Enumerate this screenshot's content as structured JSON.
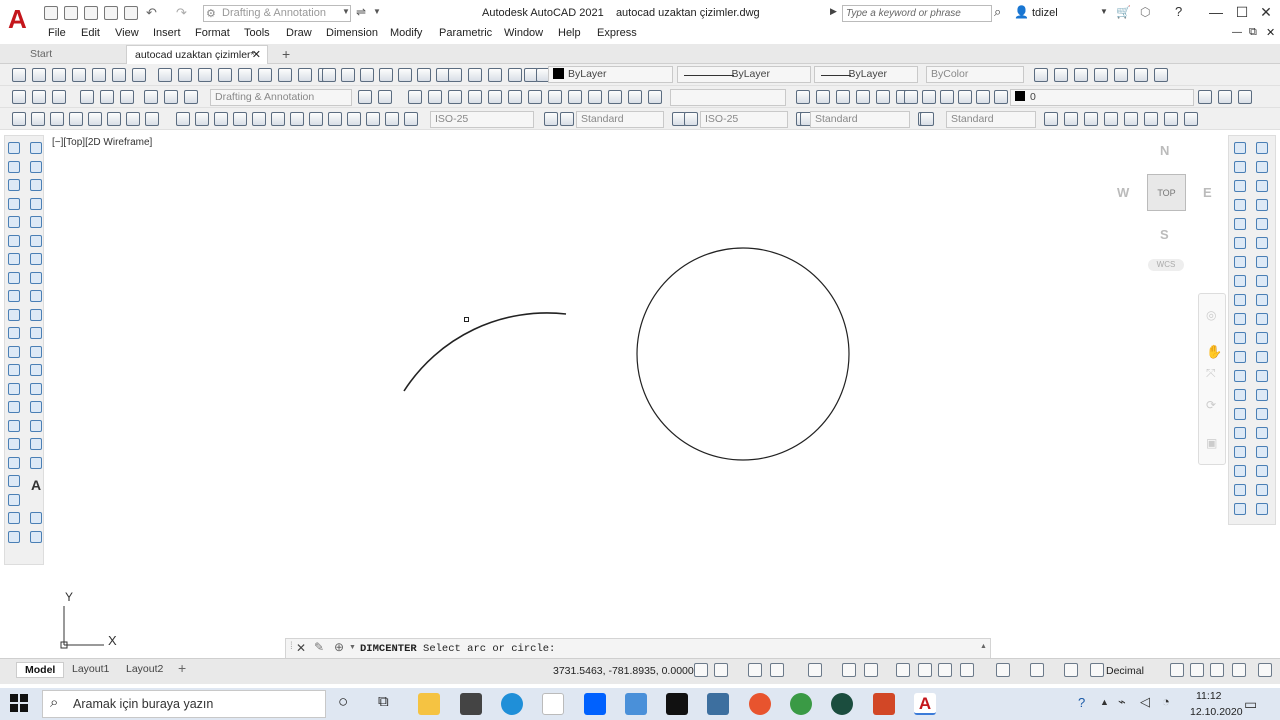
{
  "titlebar": {
    "workspace": "Drafting & Annotation",
    "app_title": "Autodesk AutoCAD 2021",
    "file_title": "autocad uzaktan çizimler.dwg",
    "search_placeholder": "Type a keyword or phrase",
    "user": "tdizel"
  },
  "menu": [
    "File",
    "Edit",
    "View",
    "Insert",
    "Format",
    "Tools",
    "Draw",
    "Dimension",
    "Modify",
    "Parametric",
    "Window",
    "Help",
    "Express"
  ],
  "tabs": {
    "start": "Start",
    "drawing": "autocad uzaktan çizimler*",
    "add": "+"
  },
  "toolbar1": {
    "color": "ByLayer",
    "linetype": "ByLayer",
    "lineweight": "ByLayer",
    "plotstyle": "ByColor"
  },
  "toolbar2": {
    "workspace": "Drafting & Annotation",
    "layer": "0"
  },
  "toolbar3": {
    "dimstyle": "ISO-25",
    "textstyle": "Standard",
    "dimstyle2": "ISO-25",
    "tablestyle": "Standard",
    "mleaderstyle": "Standard"
  },
  "viewport": {
    "label": "[−][Top][2D Wireframe]"
  },
  "viewcube": {
    "north": "N",
    "south": "S",
    "east": "E",
    "west": "W",
    "face": "TOP",
    "wcs": "WCS"
  },
  "ucs": {
    "x": "X",
    "y": "Y"
  },
  "command": {
    "name": "DIMCENTER",
    "prompt": "Select arc or circle:"
  },
  "layout_tabs": [
    "Model",
    "Layout1",
    "Layout2"
  ],
  "status": {
    "coords": "3731.5463, -781.8935, 0.0000",
    "units": "Decimal"
  },
  "taskbar": {
    "search_text": "Aramak için buraya yazın",
    "time": "11:12",
    "date": "12.10.2020"
  },
  "colors": {
    "accent": "#c4161c",
    "taskbar_bg": "#dfe7f2",
    "canvas_bg": "#ffffff"
  }
}
